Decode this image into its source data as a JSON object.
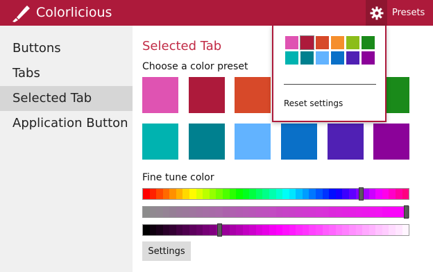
{
  "app": {
    "title": "Colorlicious",
    "icon": "brush-icon"
  },
  "header": {
    "presets_label": "Presets",
    "settings_icon": "gear-icon"
  },
  "nav": {
    "items": [
      {
        "label": "Buttons"
      },
      {
        "label": "Tabs"
      },
      {
        "label": "Selected Tab"
      },
      {
        "label": "Application Button"
      }
    ],
    "selected": "Selected Tab"
  },
  "main": {
    "title": "Selected Tab",
    "preset_label": "Choose a color preset",
    "presets": [
      [
        "#df53b2",
        "#ad1a3b",
        "#d74929",
        "#f58e2c",
        "#8cbd1a",
        "#1a8a1a"
      ],
      [
        "#00b3b0",
        "#00808f",
        "#62b3ff",
        "#0a70c8",
        "#5020b4",
        "#8b0299"
      ]
    ],
    "fine_tune_label": "Fine tune color",
    "sliders": [
      {
        "name": "hue",
        "value": 0.82
      },
      {
        "name": "saturation",
        "value": 0.99
      },
      {
        "name": "brightness",
        "value": 0.29
      }
    ],
    "settings_label": "Settings"
  },
  "dropdown": {
    "colors": [
      [
        "#df53b2",
        "#ad1a3b",
        "#d74929",
        "#f58e2c",
        "#8cbd1a",
        "#1a8a1a"
      ],
      [
        "#00b3b0",
        "#00808f",
        "#62b3ff",
        "#0a70c8",
        "#5020b4",
        "#8b0299"
      ]
    ],
    "reset_label": "Reset settings"
  },
  "colors": {
    "accent": "#ad1a3b",
    "accent_dark": "#8e1630",
    "nav_bg": "#f0f0f0",
    "nav_selected": "#d6d6d6"
  }
}
